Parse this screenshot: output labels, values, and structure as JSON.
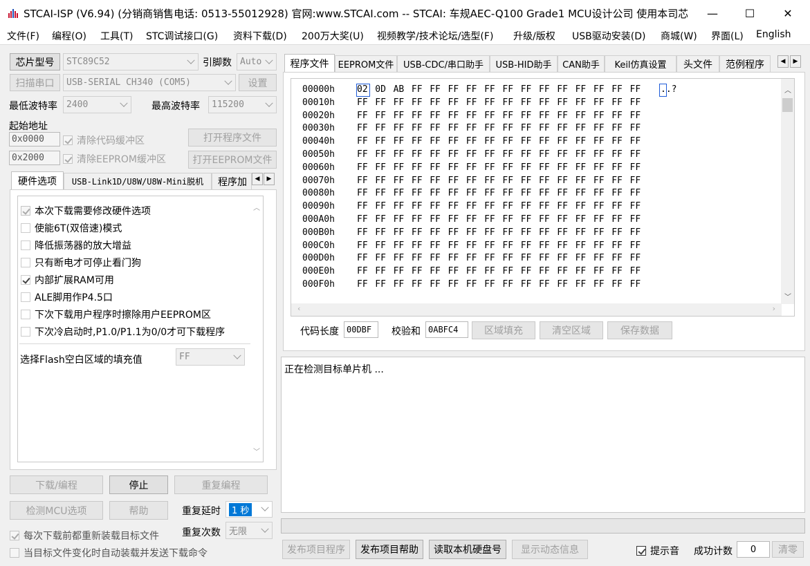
{
  "window": {
    "title": "STCAI-ISP (V6.94) (分销商销售电话: 0513-55012928) 官网:www.STCAI.com  -- STCAI: 车规AEC-Q100 Grade1 MCU设计公司 使用本司芯...",
    "minimize": "—",
    "maximize": "☐",
    "close": "✕"
  },
  "menu": [
    "文件(F)",
    "编程(O)",
    "工具(T)",
    "STC调试接口(G)",
    "资料下载(D)",
    "200万大奖(U)",
    "视频教学/技术论坛/选型(F)",
    "升级/版权",
    "USB驱动安装(D)",
    "商城(W)",
    "界面(L)",
    "English"
  ],
  "left": {
    "chip_model_btn": "芯片型号",
    "chip_model": "STC89C52",
    "pin_count_label": "引脚数",
    "pin_count": "Auto",
    "scan_port_btn": "扫描串口",
    "port": "USB-SERIAL CH340 (COM5)",
    "settings_btn": "设置",
    "min_baud_label": "最低波特率",
    "min_baud": "2400",
    "max_baud_label": "最高波特率",
    "max_baud": "115200",
    "start_addr_label": "起始地址",
    "code_addr": "0x0000",
    "clear_code_buf": "清除代码缓冲区",
    "open_program_btn": "打开程序文件",
    "eeprom_addr": "0x2000",
    "clear_eeprom_buf": "清除EEPROM缓冲区",
    "open_eeprom_btn": "打开EEPROM文件",
    "tabs": [
      "硬件选项",
      "USB-Link1D/U8W/U8W-Mini脱机",
      "程序加"
    ],
    "options": [
      {
        "label": "本次下载需要修改硬件选项",
        "checked": true,
        "disabled": true
      },
      {
        "label": "使能6T(双倍速)模式",
        "checked": false,
        "disabled": false
      },
      {
        "label": "降低振荡器的放大增益",
        "checked": false,
        "disabled": false
      },
      {
        "label": "只有断电才可停止看门狗",
        "checked": false,
        "disabled": false
      },
      {
        "label": "内部扩展RAM可用",
        "checked": true,
        "disabled": false
      },
      {
        "label": "ALE脚用作P4.5口",
        "checked": false,
        "disabled": false
      },
      {
        "label": "下次下载用户程序时擦除用户EEPROM区",
        "checked": false,
        "disabled": false
      },
      {
        "label": "下次冷启动时,P1.0/P1.1为0/0才可下载程序",
        "checked": false,
        "disabled": false
      }
    ],
    "fill_label": "选择Flash空白区域的填充值",
    "fill_value": "FF",
    "download_btn": "下载/编程",
    "stop_btn": "停止",
    "reprogram_btn": "重复编程",
    "detect_btn": "检测MCU选项",
    "help_btn": "帮助",
    "repeat_delay_label": "重复延时",
    "repeat_delay": "1 秒",
    "repeat_count_label": "重复次数",
    "repeat_count": "无限",
    "reload_each": "每次下载前都重新装载目标文件",
    "auto_reload": "当目标文件变化时自动装载并发送下载命令"
  },
  "right": {
    "tabs": [
      "程序文件",
      "EEPROM文件",
      "USB-CDC/串口助手",
      "USB-HID助手",
      "CAN助手",
      "Keil仿真设置",
      "头文件",
      "范例程序"
    ],
    "hex_rows": [
      {
        "addr": "00000h",
        "bytes": [
          "02",
          "0D",
          "AB",
          "FF",
          "FF",
          "FF",
          "FF",
          "FF",
          "FF",
          "FF",
          "FF",
          "FF",
          "FF",
          "FF",
          "FF",
          "FF"
        ],
        "ascii": "..?"
      },
      {
        "addr": "00010h",
        "bytes": [
          "FF",
          "FF",
          "FF",
          "FF",
          "FF",
          "FF",
          "FF",
          "FF",
          "FF",
          "FF",
          "FF",
          "FF",
          "FF",
          "FF",
          "FF",
          "FF"
        ],
        "ascii": ""
      },
      {
        "addr": "00020h",
        "bytes": [
          "FF",
          "FF",
          "FF",
          "FF",
          "FF",
          "FF",
          "FF",
          "FF",
          "FF",
          "FF",
          "FF",
          "FF",
          "FF",
          "FF",
          "FF",
          "FF"
        ],
        "ascii": ""
      },
      {
        "addr": "00030h",
        "bytes": [
          "FF",
          "FF",
          "FF",
          "FF",
          "FF",
          "FF",
          "FF",
          "FF",
          "FF",
          "FF",
          "FF",
          "FF",
          "FF",
          "FF",
          "FF",
          "FF"
        ],
        "ascii": ""
      },
      {
        "addr": "00040h",
        "bytes": [
          "FF",
          "FF",
          "FF",
          "FF",
          "FF",
          "FF",
          "FF",
          "FF",
          "FF",
          "FF",
          "FF",
          "FF",
          "FF",
          "FF",
          "FF",
          "FF"
        ],
        "ascii": ""
      },
      {
        "addr": "00050h",
        "bytes": [
          "FF",
          "FF",
          "FF",
          "FF",
          "FF",
          "FF",
          "FF",
          "FF",
          "FF",
          "FF",
          "FF",
          "FF",
          "FF",
          "FF",
          "FF",
          "FF"
        ],
        "ascii": ""
      },
      {
        "addr": "00060h",
        "bytes": [
          "FF",
          "FF",
          "FF",
          "FF",
          "FF",
          "FF",
          "FF",
          "FF",
          "FF",
          "FF",
          "FF",
          "FF",
          "FF",
          "FF",
          "FF",
          "FF"
        ],
        "ascii": ""
      },
      {
        "addr": "00070h",
        "bytes": [
          "FF",
          "FF",
          "FF",
          "FF",
          "FF",
          "FF",
          "FF",
          "FF",
          "FF",
          "FF",
          "FF",
          "FF",
          "FF",
          "FF",
          "FF",
          "FF"
        ],
        "ascii": ""
      },
      {
        "addr": "00080h",
        "bytes": [
          "FF",
          "FF",
          "FF",
          "FF",
          "FF",
          "FF",
          "FF",
          "FF",
          "FF",
          "FF",
          "FF",
          "FF",
          "FF",
          "FF",
          "FF",
          "FF"
        ],
        "ascii": ""
      },
      {
        "addr": "00090h",
        "bytes": [
          "FF",
          "FF",
          "FF",
          "FF",
          "FF",
          "FF",
          "FF",
          "FF",
          "FF",
          "FF",
          "FF",
          "FF",
          "FF",
          "FF",
          "FF",
          "FF"
        ],
        "ascii": ""
      },
      {
        "addr": "000A0h",
        "bytes": [
          "FF",
          "FF",
          "FF",
          "FF",
          "FF",
          "FF",
          "FF",
          "FF",
          "FF",
          "FF",
          "FF",
          "FF",
          "FF",
          "FF",
          "FF",
          "FF"
        ],
        "ascii": ""
      },
      {
        "addr": "000B0h",
        "bytes": [
          "FF",
          "FF",
          "FF",
          "FF",
          "FF",
          "FF",
          "FF",
          "FF",
          "FF",
          "FF",
          "FF",
          "FF",
          "FF",
          "FF",
          "FF",
          "FF"
        ],
        "ascii": ""
      },
      {
        "addr": "000C0h",
        "bytes": [
          "FF",
          "FF",
          "FF",
          "FF",
          "FF",
          "FF",
          "FF",
          "FF",
          "FF",
          "FF",
          "FF",
          "FF",
          "FF",
          "FF",
          "FF",
          "FF"
        ],
        "ascii": ""
      },
      {
        "addr": "000D0h",
        "bytes": [
          "FF",
          "FF",
          "FF",
          "FF",
          "FF",
          "FF",
          "FF",
          "FF",
          "FF",
          "FF",
          "FF",
          "FF",
          "FF",
          "FF",
          "FF",
          "FF"
        ],
        "ascii": ""
      },
      {
        "addr": "000E0h",
        "bytes": [
          "FF",
          "FF",
          "FF",
          "FF",
          "FF",
          "FF",
          "FF",
          "FF",
          "FF",
          "FF",
          "FF",
          "FF",
          "FF",
          "FF",
          "FF",
          "FF"
        ],
        "ascii": ""
      },
      {
        "addr": "000F0h",
        "bytes": [
          "FF",
          "FF",
          "FF",
          "FF",
          "FF",
          "FF",
          "FF",
          "FF",
          "FF",
          "FF",
          "FF",
          "FF",
          "FF",
          "FF",
          "FF",
          "FF"
        ],
        "ascii": ""
      }
    ],
    "code_len_label": "代码长度",
    "code_len": "00DBF",
    "checksum_label": "校验和",
    "checksum": "0ABFC4",
    "fill_region_btn": "区域填充",
    "clear_region_btn": "清空区域",
    "save_data_btn": "保存数据",
    "log_text": "正在检测目标单片机 ...",
    "publish_program_btn": "发布项目程序",
    "publish_help_btn": "发布项目帮助",
    "read_disk_btn": "读取本机硬盘号",
    "show_dynamic_btn": "显示动态信息",
    "beep_label": "提示音",
    "success_count_label": "成功计数",
    "success_count": "0",
    "clear_btn": "清零"
  },
  "colors": {
    "accent": "#0078d7",
    "select_box": "#1e5bd8"
  }
}
